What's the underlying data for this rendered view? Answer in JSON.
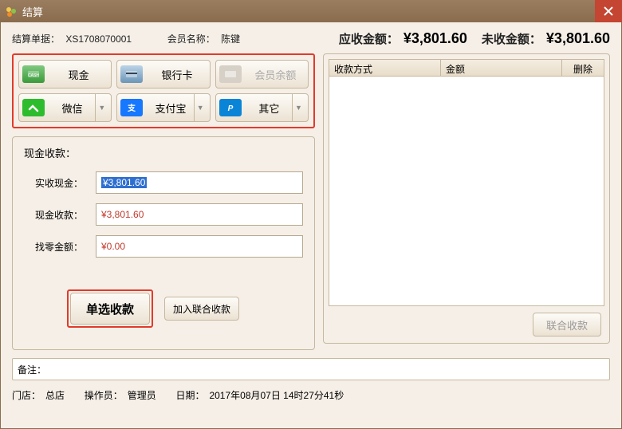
{
  "title": "结算",
  "header": {
    "order_label": "结算单据：",
    "order_no": "XS1708070001",
    "member_label": "会员名称：",
    "member_name": "陈键",
    "receivable_label": "应收金额：",
    "receivable_value": "¥3,801.60",
    "uncollected_label": "未收金额：",
    "uncollected_value": "¥3,801.60"
  },
  "pay_methods": {
    "cash": "现金",
    "bank": "银行卡",
    "member": "会员余额",
    "wechat": "微信",
    "alipay": "支付宝",
    "other": "其它"
  },
  "cash_panel": {
    "title": "现金收款：",
    "actual_label": "实收现金：",
    "actual_value": "¥3,801.60",
    "cash_label": "现金收款：",
    "cash_value": "¥3,801.60",
    "change_label": "找零金额：",
    "change_value": "¥0.00",
    "single_btn": "单选收款",
    "add_combined_btn": "加入联合收款"
  },
  "collect_table": {
    "col_method": "收款方式",
    "col_amount": "金额",
    "col_delete": "删除",
    "rows": []
  },
  "combined_btn": "联合收款",
  "remark_label": "备注：",
  "remark_value": "",
  "status": {
    "store_label": "门店：",
    "store": "总店",
    "operator_label": "操作员：",
    "operator": "管理员",
    "date_label": "日期：",
    "date": "2017年08月07日 14时27分41秒"
  }
}
